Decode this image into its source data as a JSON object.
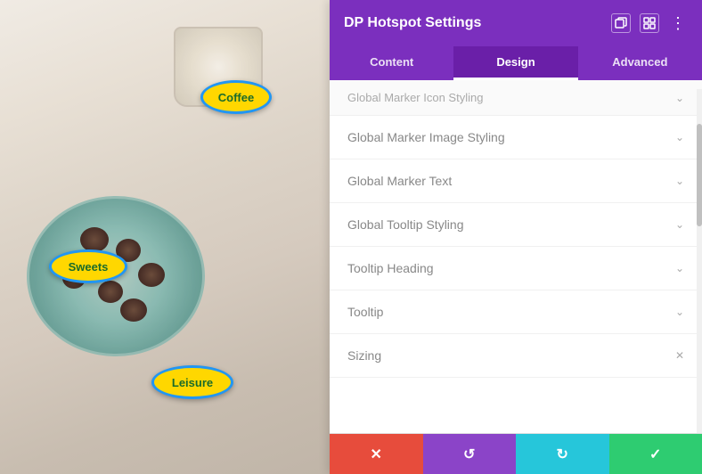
{
  "panel": {
    "title": "DP Hotspot Settings",
    "tabs": [
      {
        "label": "Content",
        "active": false
      },
      {
        "label": "Design",
        "active": true
      },
      {
        "label": "Advanced",
        "active": false
      }
    ],
    "settings": [
      {
        "label": "Global Marker Icon Styling",
        "visible_partial": true
      },
      {
        "label": "Global Marker Image Styling"
      },
      {
        "label": "Global Marker Text"
      },
      {
        "label": "Global Tooltip Styling"
      },
      {
        "label": "Tooltip Heading"
      },
      {
        "label": "Tooltip"
      },
      {
        "label": "Sizing"
      }
    ]
  },
  "hotspots": [
    {
      "label": "Coffee",
      "class": "hotspot-coffee"
    },
    {
      "label": "Sweets",
      "class": "hotspot-sweets"
    },
    {
      "label": "Leisure",
      "class": "hotspot-leisure"
    }
  ],
  "toolbar": {
    "cancel_icon": "✕",
    "undo_icon": "↺",
    "redo_icon": "↻",
    "save_icon": "✓"
  },
  "icons": {
    "restore": "⊡",
    "grid": "⊞",
    "more": "⋮",
    "chevron_down": "∨"
  }
}
